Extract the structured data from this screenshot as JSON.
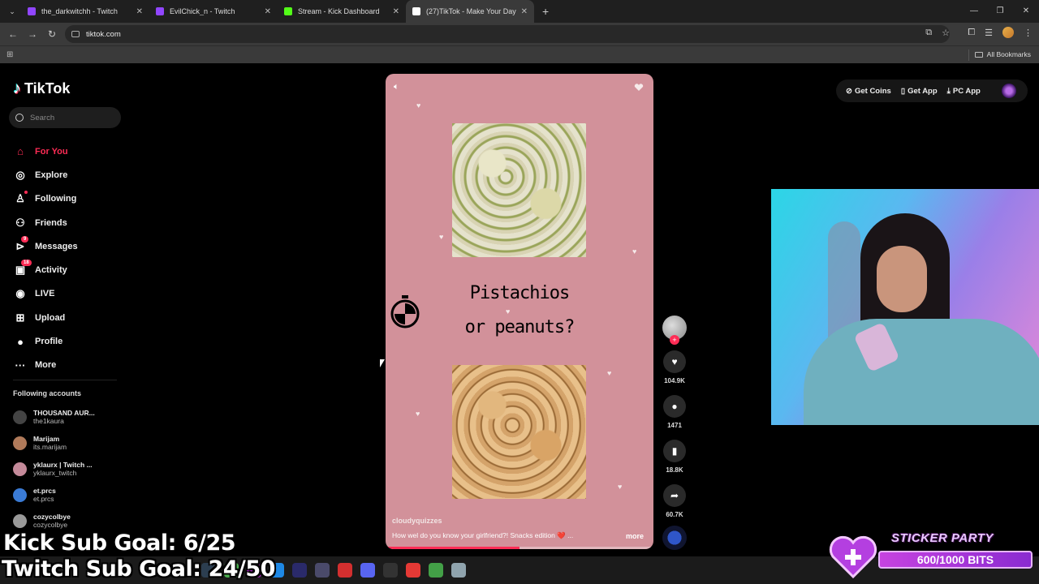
{
  "browser": {
    "tabs": [
      {
        "title": "the_darkwitchh - Twitch",
        "color": "#9146ff",
        "active": false
      },
      {
        "title": "EvilChick_n - Twitch",
        "color": "#9146ff",
        "active": false
      },
      {
        "title": "Stream - Kick Dashboard",
        "color": "#53fc18",
        "active": false
      },
      {
        "title": "(27)TikTok - Make Your Day",
        "color": "#ffffff",
        "active": true
      }
    ],
    "url": "tiktok.com",
    "bookmarks_label": "All Bookmarks"
  },
  "tiktok": {
    "logo": "TikTok",
    "search_placeholder": "Search",
    "nav": [
      {
        "label": "For You",
        "icon": "home-icon",
        "glyph": "⌂",
        "active": true,
        "badge": ""
      },
      {
        "label": "Explore",
        "icon": "compass-icon",
        "glyph": "◎",
        "active": false,
        "badge": ""
      },
      {
        "label": "Following",
        "icon": "user-icon",
        "glyph": "♙",
        "active": false,
        "badge": "dot"
      },
      {
        "label": "Friends",
        "icon": "friends-icon",
        "glyph": "⚇",
        "active": false,
        "badge": ""
      },
      {
        "label": "Messages",
        "icon": "send-icon",
        "glyph": "⊳",
        "active": false,
        "badge": "9"
      },
      {
        "label": "Activity",
        "icon": "inbox-icon",
        "glyph": "▣",
        "active": false,
        "badge": "18"
      },
      {
        "label": "LIVE",
        "icon": "live-icon",
        "glyph": "◉",
        "active": false,
        "badge": ""
      },
      {
        "label": "Upload",
        "icon": "plus-square-icon",
        "glyph": "⊞",
        "active": false,
        "badge": ""
      },
      {
        "label": "Profile",
        "icon": "profile-icon",
        "glyph": "●",
        "active": false,
        "badge": ""
      },
      {
        "label": "More",
        "icon": "more-icon",
        "glyph": "···",
        "active": false,
        "badge": ""
      }
    ],
    "following_heading": "Following accounts",
    "following": [
      {
        "name": "THOUSAND AUR...",
        "handle": "the1kaura",
        "color": "#444444"
      },
      {
        "name": "Marijam",
        "handle": "its.marijam",
        "color": "#b07a5a"
      },
      {
        "name": "yklaurx | Twitch ...",
        "handle": "yklaurx_twitch",
        "color": "#c48a9a"
      },
      {
        "name": "et.prcs",
        "handle": "et.prcs",
        "color": "#3a7bd5"
      },
      {
        "name": "cozycolbye",
        "handle": "cozycolbye",
        "color": "#999999"
      }
    ],
    "top_actions": [
      {
        "label": "Get Coins",
        "icon": "coin-icon",
        "glyph": "⊘"
      },
      {
        "label": "Get App",
        "icon": "phone-icon",
        "glyph": "▯"
      },
      {
        "label": "PC App",
        "icon": "download-icon",
        "glyph": "⤓"
      }
    ],
    "video": {
      "title_line1": "Pistachios",
      "title_line2": "or peanuts?",
      "author": "cloudyquizzes",
      "description": "How wel do you know your girlfriend?! Snacks edition ❤️ ...",
      "more": "more",
      "progress": 0.5
    },
    "actions": [
      {
        "name": "like",
        "icon": "heart-icon",
        "glyph": "♥",
        "count": "104.9K"
      },
      {
        "name": "comment",
        "icon": "comment-icon",
        "glyph": "●",
        "count": "1471"
      },
      {
        "name": "save",
        "icon": "bookmark-icon",
        "glyph": "▮",
        "count": "18.8K"
      },
      {
        "name": "share",
        "icon": "share-icon",
        "glyph": "➦",
        "count": "60.7K"
      }
    ]
  },
  "overlay": {
    "kick_goal": "Kick Sub Goal: 6/25",
    "twitch_goal": "Twitch Sub Goal: 24/50",
    "sticker_title": "STICKER PARTY",
    "sticker_bits": "600/1000 BITS"
  }
}
